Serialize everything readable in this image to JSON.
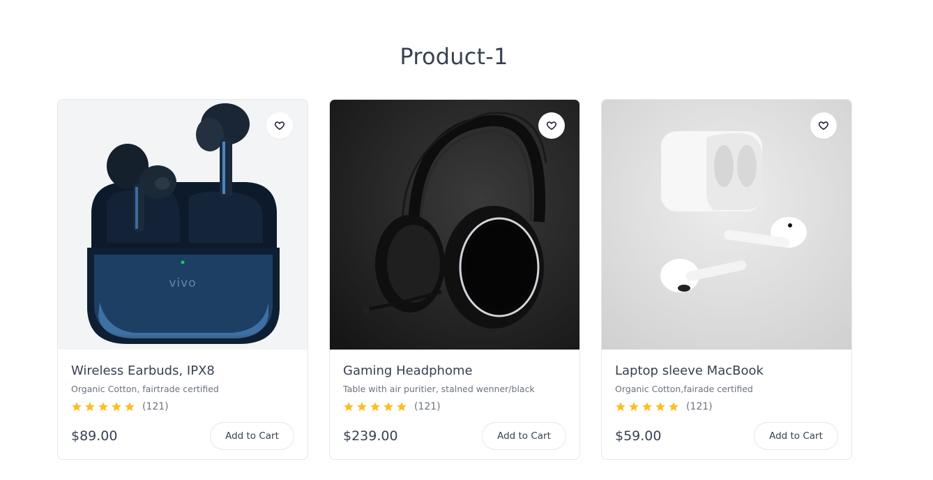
{
  "page": {
    "title": "Product-1"
  },
  "colors": {
    "star": "#fbbf24",
    "text": "#374151",
    "muted": "#6b7280",
    "border": "#e5e7eb"
  },
  "products": [
    {
      "name": "Wireless Earbuds, IPX8",
      "description": "Organic Cotton, fairtrade certified",
      "rating": 5,
      "reviews": "(121)",
      "price": "$89.00",
      "cta": "Add to Cart",
      "image": "earbuds-vivo-photo",
      "brand_mark": "vivo"
    },
    {
      "name": "Gaming Headphome",
      "description": "Table with air puritier, stalned wenner/black",
      "rating": 5,
      "reviews": "(121)",
      "price": "$239.00",
      "cta": "Add to Cart",
      "image": "gaming-headphone-photo"
    },
    {
      "name": "Laptop sleeve MacBook",
      "description": "Organic Cotton,fairade certified",
      "rating": 5,
      "reviews": "(121)",
      "price": "$59.00",
      "cta": "Add to Cart",
      "image": "white-earbuds-photo"
    }
  ]
}
